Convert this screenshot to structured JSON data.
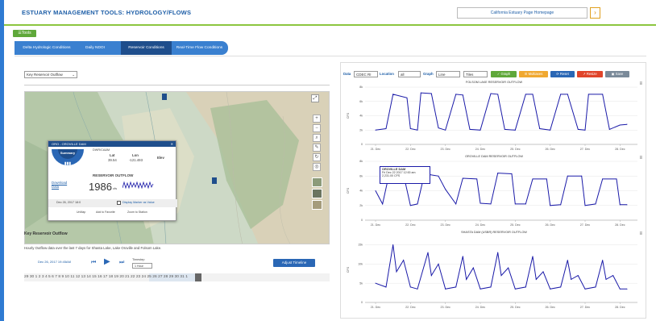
{
  "header": {
    "title": "ESTUARY MANAGEMENT TOOLS: HYDROLOGY/FLOWS",
    "home_label": "California Estuary Page Homepage",
    "arrow": "›"
  },
  "tools_label": "☰Tools",
  "tabs": [
    {
      "label": "Delta Hydrologic Conditions"
    },
    {
      "label": "Daily NDOI"
    },
    {
      "label": "Reservoir Conditions"
    },
    {
      "label": "Real-Time Flow Conditions"
    }
  ],
  "left": {
    "dropdown": "Key Reservoir Outflow",
    "popup": {
      "title": "ORO - OROVILLE DAM",
      "summary_tab": "Summary",
      "owner": "DWR/CA&M",
      "lat_label": "Lat",
      "lat": "39.54",
      "lon_label": "Lon",
      "lon": "-121.493",
      "elev_label": "Elev",
      "outflow_title": "RESERVOIR OUTFLOW",
      "download": "Download Data",
      "value": "1986",
      "unit": "cfs",
      "date": "Dec 26, 2017 18:0",
      "display_marker": "Display Marker as Value",
      "links": [
        "UnMap",
        "Add to Favorite",
        "Zoom to Station"
      ]
    },
    "section_title": "Key Reservoir Outflow",
    "description": "Hourly Outflow data over the last 7 days for Shasta Lake, Lake Oroville and Folsom Lake.",
    "timeline_date": "Dec 26, 2017 19:45AM",
    "timestep_label": "Timestep",
    "timestep_value": "1 Hour",
    "adjust_btn": "Adjust Timeline",
    "timeline_text": "29 30 1 2 3 4 5 6 7 8 9 10 11 12 13 14 15 16 17 18 19 20 21 22 23 24 25 26 27 28 29 30 31 1"
  },
  "right": {
    "data_label": "Data",
    "data_value": "CDEC RI",
    "location_label": "Location",
    "location_value": "all",
    "graph_label": "Graph",
    "graph_value": "Line",
    "tiles_value": "Tiles",
    "buttons": {
      "graph": "✓ Graph",
      "multiaxes": "☰ Multiaxes",
      "reset": "⟳ Reset",
      "resize": "↗ Resize",
      "save": "▣ Save"
    },
    "tooltip": {
      "title": "OROVILLE DAM",
      "date": "Fri Dec 22 2017 12:00 am",
      "value": "2,231.00 CFS"
    }
  },
  "colors": {
    "accent": "#2f7bd2",
    "green": "#5fa83a",
    "line": "#1a1aa8"
  },
  "chart_data": [
    {
      "type": "line",
      "title": "FOLSOM LAKE RESERVOIR OUTFLOW",
      "ylabel": "CFS",
      "categories": [
        "21. Dec",
        "22. Dec",
        "23. Dec",
        "24. Dec",
        "25. Dec",
        "26. Dec",
        "27. Dec",
        "28. Dec"
      ],
      "yticks": [
        "0",
        "2k",
        "4k",
        "6k",
        "8k"
      ],
      "ylim": [
        0,
        8000
      ],
      "x": [
        0,
        0.3,
        0.5,
        0.9,
        1.0,
        1.2,
        1.3,
        1.6,
        1.8,
        2.0,
        2.3,
        2.5,
        2.7,
        3.0,
        3.3,
        3.5,
        3.7,
        4.0,
        4.3,
        4.5,
        4.7,
        5.0,
        5.3,
        5.5,
        5.8,
        6.0,
        6.1,
        6.5,
        6.7,
        7.0,
        7.2
      ],
      "values": [
        2000,
        2200,
        7000,
        6500,
        2200,
        2000,
        7200,
        7100,
        2300,
        2000,
        7000,
        6900,
        2100,
        2000,
        7100,
        7000,
        2100,
        2000,
        7000,
        7000,
        2200,
        2000,
        7000,
        7000,
        2100,
        2000,
        7000,
        7000,
        2100,
        2700,
        2800
      ]
    },
    {
      "type": "line",
      "title": "OROVILLE DAM RESERVOIR OUTFLOW",
      "ylabel": "CFS",
      "categories": [
        "21. Dec",
        "22. Dec",
        "23. Dec",
        "24. Dec",
        "25. Dec",
        "26. Dec",
        "27. Dec",
        "28. Dec"
      ],
      "yticks": [
        "0",
        "2k",
        "4k",
        "6k",
        "8k"
      ],
      "ylim": [
        0,
        8000
      ],
      "x": [
        0,
        0.2,
        0.4,
        0.8,
        1.0,
        1.2,
        1.4,
        1.8,
        2.0,
        2.3,
        2.5,
        2.9,
        3.0,
        3.3,
        3.5,
        3.9,
        4.0,
        4.3,
        4.5,
        4.9,
        5.0,
        5.3,
        5.5,
        5.9,
        6.0,
        6.3,
        6.5,
        6.9,
        7.0,
        7.2
      ],
      "values": [
        4000,
        2200,
        6500,
        6200,
        2000,
        2200,
        6300,
        6000,
        4200,
        2200,
        5700,
        5600,
        2300,
        2200,
        6400,
        6300,
        2200,
        2200,
        5600,
        5600,
        2000,
        2100,
        6000,
        6000,
        2000,
        2200,
        5600,
        5600,
        2100,
        2100
      ]
    },
    {
      "type": "line",
      "title": "SHASTA DAM (USBR) RESERVOIR OUTFLOW",
      "ylabel": "CFS",
      "categories": [
        "21. Dec",
        "22. Dec",
        "23. Dec",
        "24. Dec",
        "25. Dec",
        "26. Dec",
        "27. Dec",
        "28. Dec"
      ],
      "yticks": [
        "0",
        "5k",
        "10k",
        "15k"
      ],
      "ylim": [
        0,
        17000
      ],
      "x": [
        0,
        0.3,
        0.5,
        0.6,
        0.8,
        1.0,
        1.2,
        1.5,
        1.6,
        1.8,
        2.0,
        2.3,
        2.5,
        2.6,
        2.8,
        3.0,
        3.3,
        3.5,
        3.6,
        3.8,
        4.0,
        4.3,
        4.5,
        4.6,
        4.8,
        5.0,
        5.3,
        5.5,
        5.6,
        5.8,
        6.0,
        6.3,
        6.5,
        6.6,
        6.8,
        7.0,
        7.2
      ],
      "values": [
        5000,
        4000,
        15000,
        8000,
        11000,
        4000,
        3500,
        13000,
        7000,
        10000,
        3500,
        4000,
        12000,
        6000,
        9000,
        3500,
        4000,
        13000,
        7000,
        9000,
        3500,
        4000,
        12000,
        6000,
        8000,
        3500,
        4000,
        11000,
        6000,
        7000,
        3500,
        4000,
        11000,
        6000,
        7000,
        3500,
        3500
      ]
    }
  ]
}
